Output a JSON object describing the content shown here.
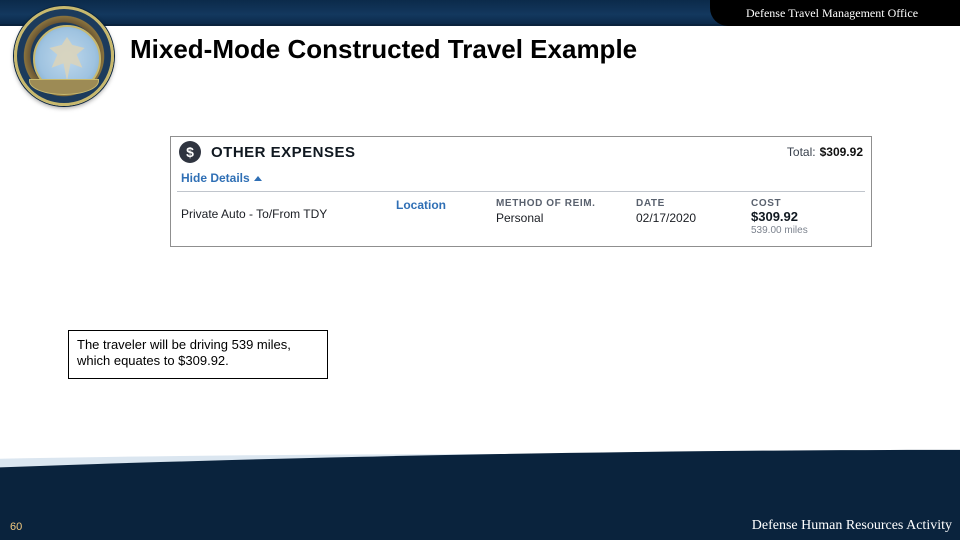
{
  "header": {
    "right_tab": "Defense Travel Management Office"
  },
  "title": "Mixed-Mode Constructed Travel Example",
  "expense": {
    "icon_glyph": "$",
    "section_title": "OTHER EXPENSES",
    "total_label": "Total:",
    "total_value": "$309.92",
    "hide_details_label": "Hide Details",
    "columns": {
      "location": "Location",
      "method": "METHOD OF REIM.",
      "date": "DATE",
      "cost": "COST"
    },
    "row": {
      "description": "Private Auto - To/From TDY",
      "method_value": "Personal",
      "date_value": "02/17/2020",
      "cost_value": "$309.92",
      "cost_miles": "539.00 miles"
    }
  },
  "callout": "The traveler will be driving 539 miles, which equates to $309.92.",
  "footer": {
    "page_number": "60",
    "right_text": "Defense Human Resources Activity"
  }
}
